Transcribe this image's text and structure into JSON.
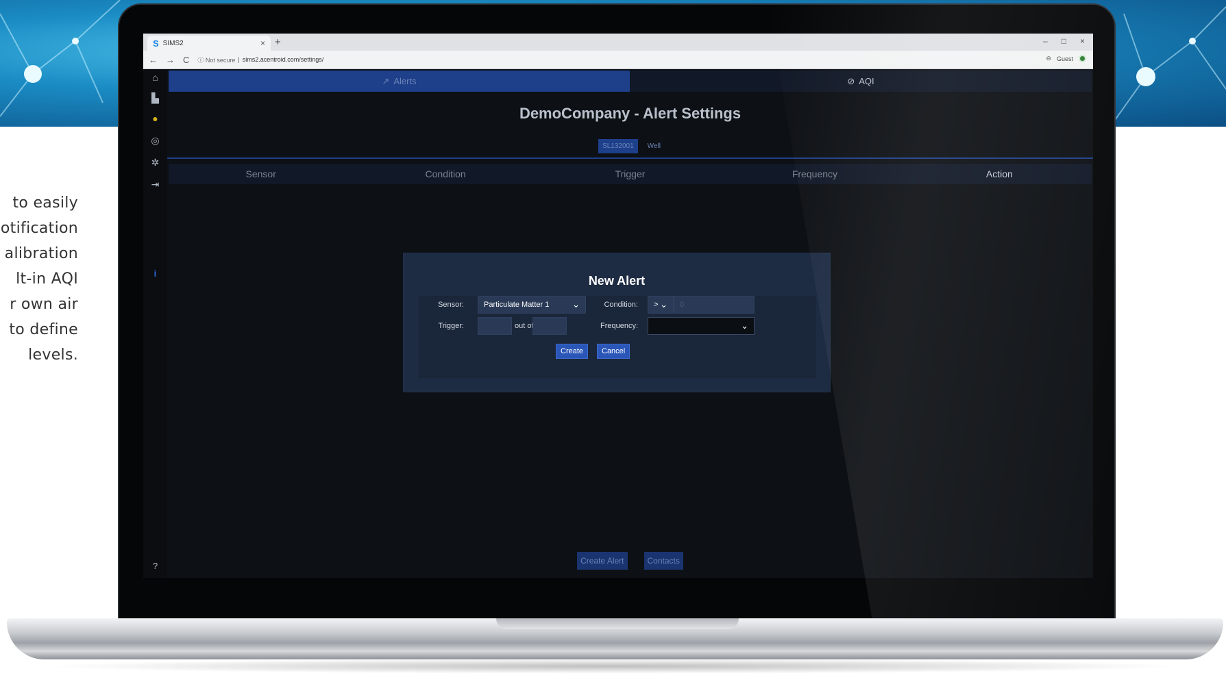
{
  "side_text": {
    "lines": [
      "to easily",
      "otification",
      "alibration",
      "lt-in AQI",
      "r own air",
      "to define",
      "levels."
    ]
  },
  "browser": {
    "tab_favicon": "S",
    "tab_title": "SIMS2",
    "tab_close": "×",
    "new_tab": "+",
    "window_controls": [
      "–",
      "□",
      "×"
    ],
    "nav": {
      "back": "←",
      "forward": "→",
      "reload": "C"
    },
    "url": {
      "security": "ⓘ Not secure",
      "separator": "|",
      "address": "sims2.acentroid.com/settings/"
    },
    "profile_label": "Guest"
  },
  "app": {
    "rail_icons": [
      "home-icon",
      "chart-icon",
      "alert-icon",
      "target-icon",
      "gear-icon",
      "logout-icon",
      "info-icon",
      "help-icon"
    ],
    "tabs": {
      "alerts": {
        "icon": "↗",
        "label": "Alerts"
      },
      "aqi": {
        "icon": "⃠",
        "label": "AQI"
      }
    },
    "page_title": "DemoCompany - Alert Settings",
    "chips": {
      "sensor_id": "SL132001",
      "well": "Well"
    },
    "table_headers": [
      "Sensor",
      "Condition",
      "Trigger",
      "Frequency",
      "Action"
    ],
    "bottom_buttons": {
      "create_alert": "Create Alert",
      "contacts": "Contacts"
    }
  },
  "modal": {
    "title": "New Alert",
    "sensor_label": "Sensor:",
    "sensor_value": "Particulate Matter 1",
    "condition_label": "Condition:",
    "condition_value": ">",
    "condition_input": "0",
    "trigger_label": "Trigger:",
    "out_of_label": "out of",
    "frequency_label": "Frequency:",
    "frequency_value": "",
    "create_button": "Create",
    "cancel_button": "Cancel"
  },
  "colors": {
    "app_background": "#0d1014",
    "active_tab": "#1e3f8a",
    "modal_background": "#1d2b43",
    "button_primary": "#2a56b8"
  }
}
